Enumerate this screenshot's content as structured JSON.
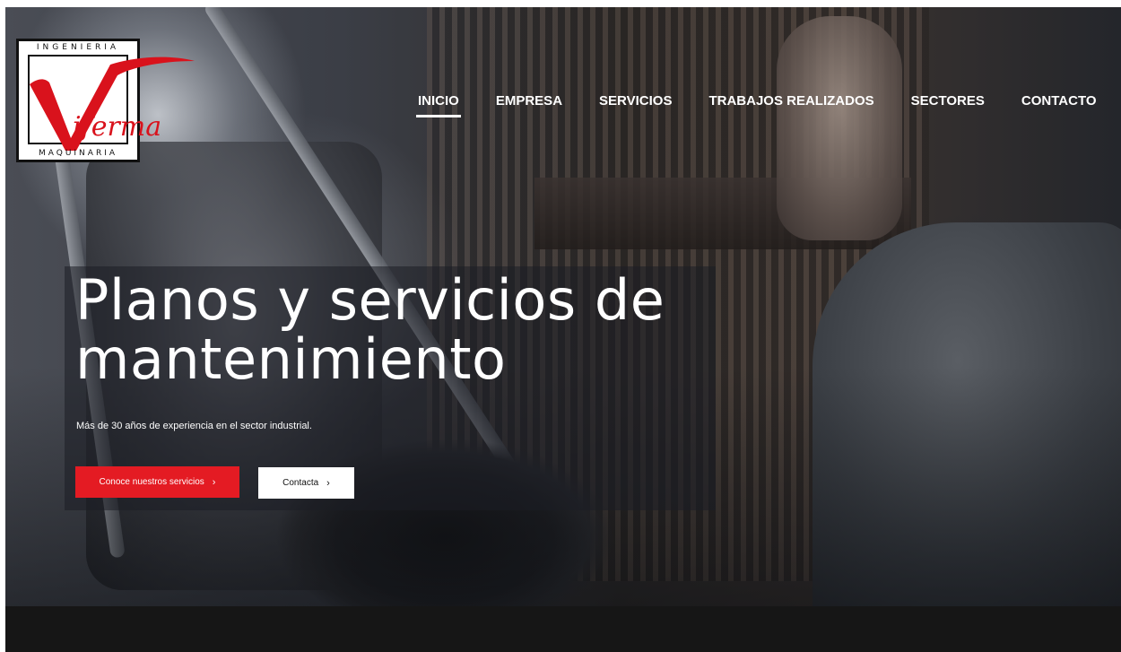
{
  "logo": {
    "top_text": "INGENIERIA",
    "word": "iferma",
    "bottom_text": "MAQUINARIA",
    "accent_color": "#d9121c"
  },
  "nav": {
    "items": [
      {
        "label": "INICIO",
        "active": true
      },
      {
        "label": "EMPRESA",
        "active": false
      },
      {
        "label": "SERVICIOS",
        "active": false
      },
      {
        "label": "TRABAJOS REALIZADOS",
        "active": false
      },
      {
        "label": "SECTORES",
        "active": false
      },
      {
        "label": "CONTACTO",
        "active": false
      }
    ]
  },
  "hero": {
    "title_line1": "Planos y servicios de",
    "title_line2": "mantenimiento",
    "subtitle": "Más de 30 años de experiencia en el sector industrial.",
    "primary_button": {
      "label": "Conoce nuestros servicios",
      "icon": "chevron-right-icon",
      "color": "#e41b23"
    },
    "secondary_button": {
      "label": "Contacta",
      "icon": "chevron-right-icon"
    }
  },
  "colors": {
    "brand_red": "#e41b23",
    "dark_band": "#161616",
    "text_on_dark": "#ffffff"
  }
}
